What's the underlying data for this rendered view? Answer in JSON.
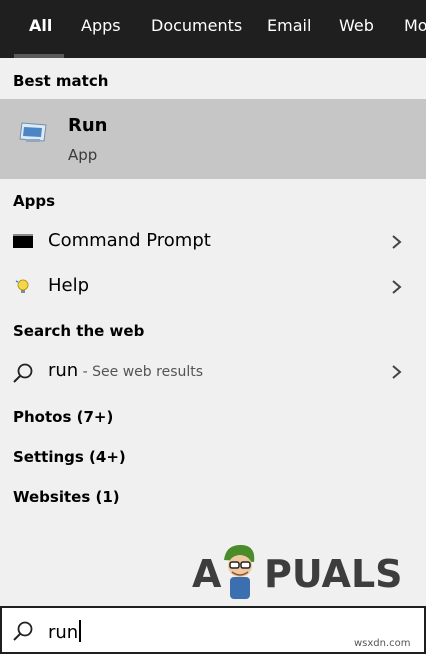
{
  "tabs": [
    {
      "label": "All",
      "active": true
    },
    {
      "label": "Apps"
    },
    {
      "label": "Documents"
    },
    {
      "label": "Email"
    },
    {
      "label": "Web"
    },
    {
      "label": "Mo"
    }
  ],
  "best_match": {
    "heading": "Best match",
    "title": "Run",
    "subtitle": "App",
    "icon": "run-app-icon"
  },
  "apps_section": {
    "heading": "Apps",
    "items": [
      {
        "label": "Command Prompt",
        "icon": "command-prompt-icon"
      },
      {
        "label": "Help",
        "icon": "help-lightbulb-icon"
      }
    ]
  },
  "web_section": {
    "heading": "Search the web",
    "query": "run",
    "suffix": " - See web results"
  },
  "categories": [
    {
      "label": "Photos (7+)"
    },
    {
      "label": "Settings (4+)"
    },
    {
      "label": "Websites (1)"
    }
  ],
  "watermark": {
    "left": "A",
    "right": "PUALS"
  },
  "search": {
    "value": "run"
  },
  "credit": "wsxdn.com",
  "colors": {
    "topbar": "#1f1f1f",
    "selected": "#c6c6c6",
    "background": "#f0f0f0"
  }
}
